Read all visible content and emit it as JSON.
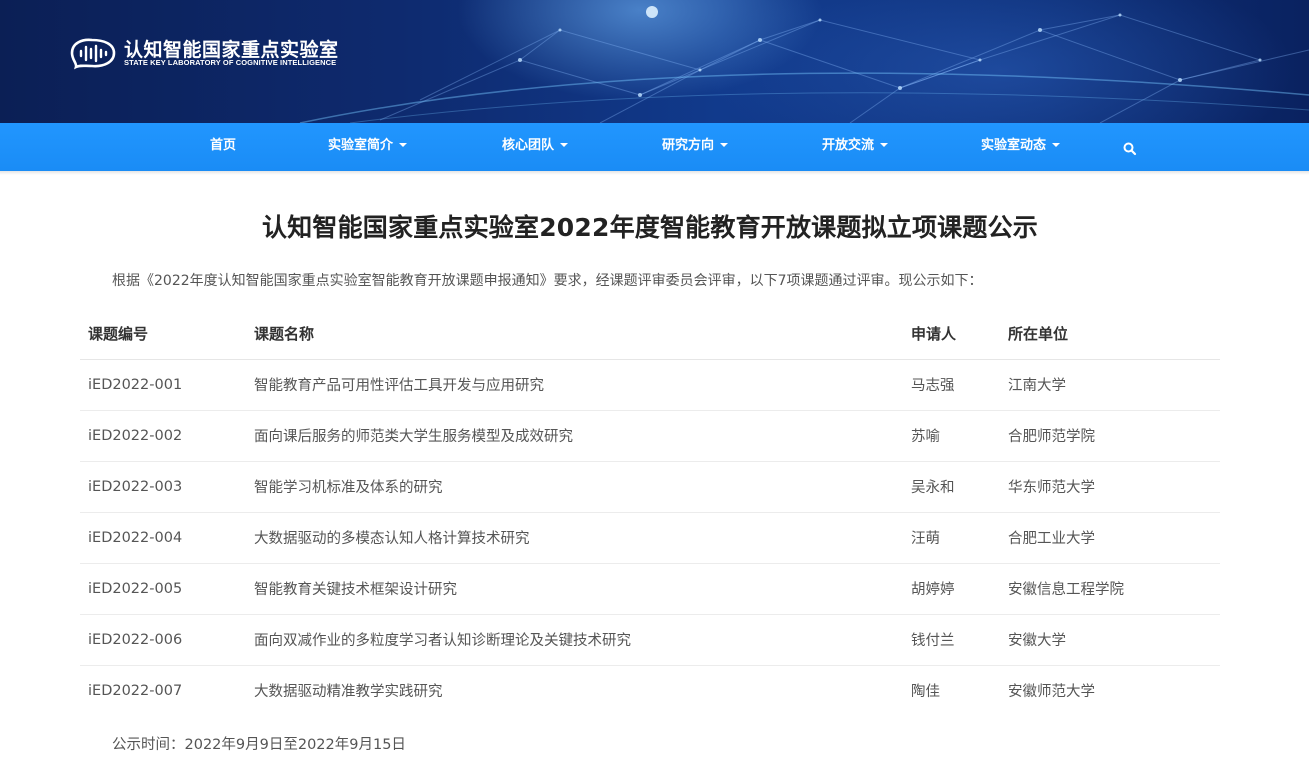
{
  "header": {
    "title_cn": "认知智能国家重点实验室",
    "title_en": "STATE KEY LABORATORY OF COGNITIVE INTELLIGENCE",
    "logo_icon": "brain-wave-icon"
  },
  "nav": {
    "items": [
      {
        "label": "首页",
        "dropdown": false
      },
      {
        "label": "实验室简介",
        "dropdown": true
      },
      {
        "label": "核心团队",
        "dropdown": true
      },
      {
        "label": "研究方向",
        "dropdown": true
      },
      {
        "label": "开放交流",
        "dropdown": true
      },
      {
        "label": "实验室动态",
        "dropdown": true
      }
    ],
    "search_icon": "search-icon",
    "color": "#1e90ff"
  },
  "article": {
    "title": "认知智能国家重点实验室2022年度智能教育开放课题拟立项课题公示",
    "intro": "根据《2022年度认知智能国家重点实验室智能教育开放课题申报通知》要求，经课题评审委员会评审，以下7项课题通过评审。现公示如下：",
    "table": {
      "headers": [
        "课题编号",
        "课题名称",
        "申请人",
        "所在单位"
      ],
      "rows": [
        [
          "iED2022-001",
          "智能教育产品可用性评估工具开发与应用研究",
          "马志强",
          "江南大学"
        ],
        [
          "iED2022-002",
          "面向课后服务的师范类大学生服务模型及成效研究",
          "苏喻",
          "合肥师范学院"
        ],
        [
          "iED2022-003",
          "智能学习机标准及体系的研究",
          "吴永和",
          "华东师范大学"
        ],
        [
          "iED2022-004",
          "大数据驱动的多模态认知人格计算技术研究",
          "汪萌",
          "合肥工业大学"
        ],
        [
          "iED2022-005",
          "智能教育关键技术框架设计研究",
          "胡婷婷",
          "安徽信息工程学院"
        ],
        [
          "iED2022-006",
          "面向双减作业的多粒度学习者认知诊断理论及关键技术研究",
          "钱付兰",
          "安徽大学"
        ],
        [
          "iED2022-007",
          "大数据驱动精准教学实践研究",
          "陶佳",
          "安徽师范大学"
        ]
      ]
    },
    "publicity_time": "公示时间：2022年9月9日至2022年9月15日"
  }
}
